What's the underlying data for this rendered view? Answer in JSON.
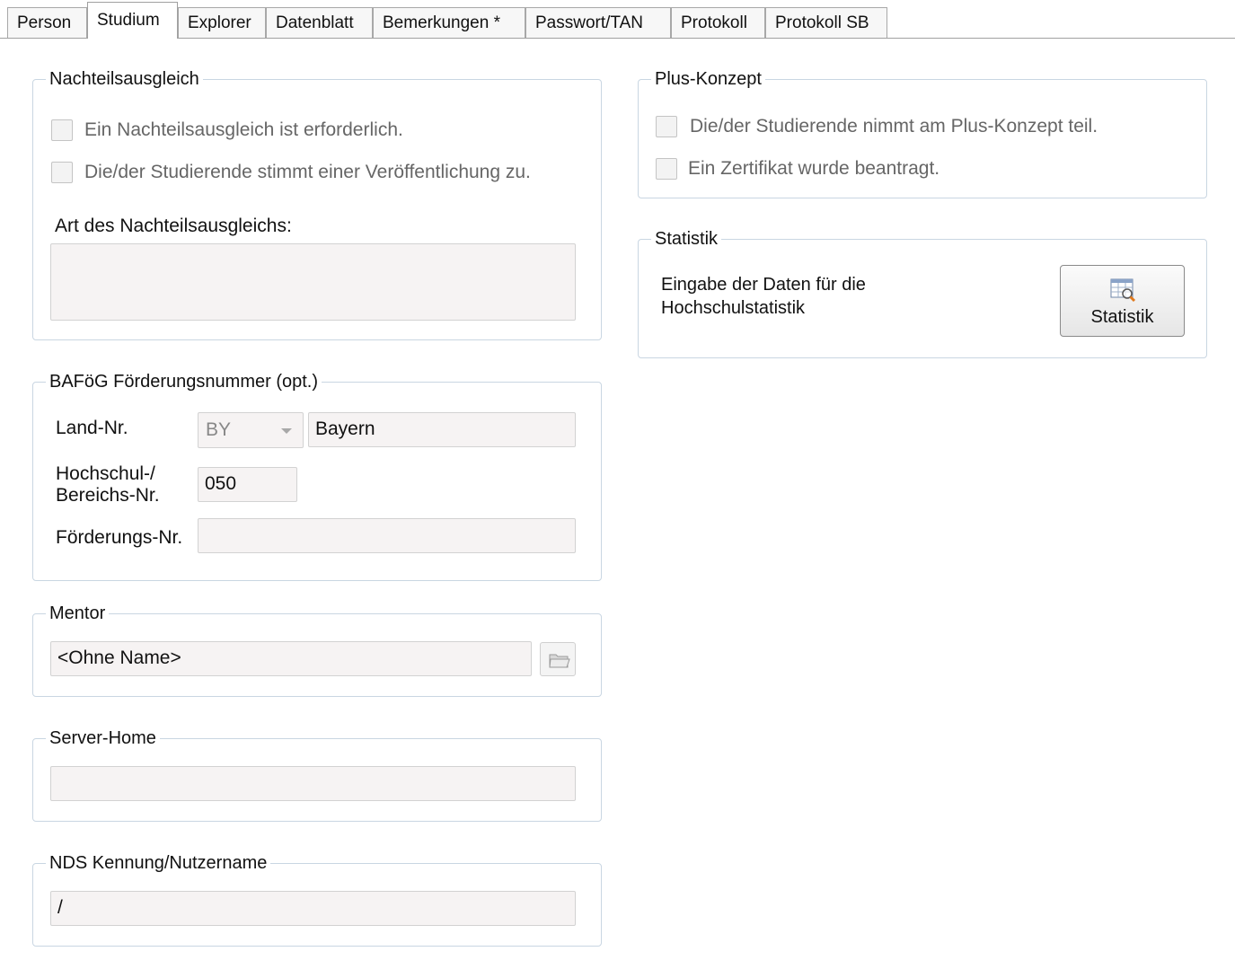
{
  "tabs": [
    {
      "label": "Person",
      "active": false
    },
    {
      "label": "Studium",
      "active": true
    },
    {
      "label": "Explorer",
      "active": false
    },
    {
      "label": "Datenblatt",
      "active": false
    },
    {
      "label": "Bemerkungen *",
      "active": false
    },
    {
      "label": "Passwort/TAN",
      "active": false
    },
    {
      "label": "Protokoll",
      "active": false
    },
    {
      "label": "Protokoll SB",
      "active": false
    }
  ],
  "nachteil": {
    "title": "Nachteilsausgleich",
    "checkbox1": "Ein Nachteilsausgleich ist erforderlich.",
    "checkbox2": "Die/der Studierende stimmt einer Veröffentlichung zu.",
    "art_label": "Art des Nachteilsausgleichs:",
    "art_value": ""
  },
  "bafoeg": {
    "title": "BAFöG Förderungsnummer (opt.)",
    "land_label": "Land-Nr.",
    "land_code": "BY",
    "land_name": "Bayern",
    "hochschul_label_1": "Hochschul-/",
    "hochschul_label_2": "Bereichs-Nr.",
    "hochschul_value": "050",
    "foerder_label": "Förderungs-Nr.",
    "foerder_value": ""
  },
  "mentor": {
    "title": "Mentor",
    "value": "<Ohne Name>"
  },
  "server_home": {
    "title": "Server-Home",
    "value": ""
  },
  "nds": {
    "title": "NDS Kennung/Nutzername",
    "value": "/"
  },
  "plus": {
    "title": "Plus-Konzept",
    "checkbox1": "Die/der Studierende nimmt am Plus-Konzept teil.",
    "checkbox2": "Ein Zertifikat wurde beantragt."
  },
  "statistik": {
    "title": "Statistik",
    "desc_1": "Eingabe der Daten für die",
    "desc_2": "Hochschulstatistik",
    "button_label": "Statistik"
  }
}
